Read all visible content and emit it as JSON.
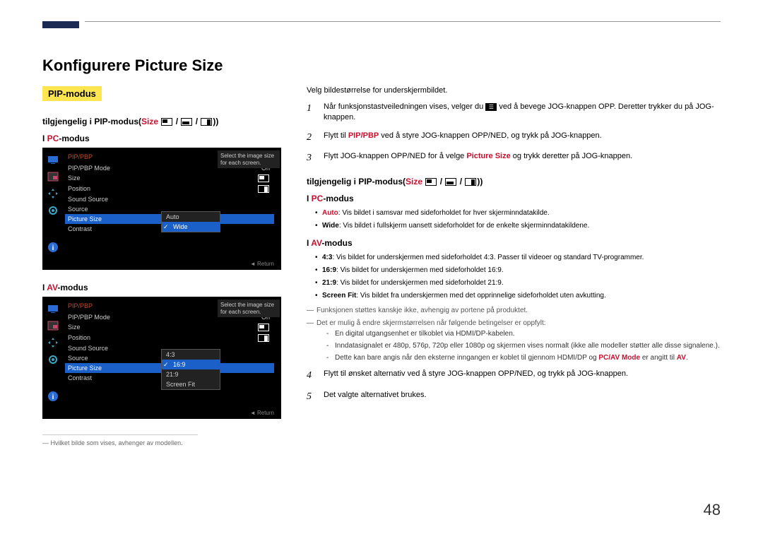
{
  "pageNumber": "48",
  "title": "Konfigurere Picture Size",
  "badge": "PIP-modus",
  "leftCol": {
    "subheadAvailable": "tilgjengelig i PIP-modus(",
    "subheadSize": "Size",
    "subheadEnd": "))",
    "pcModePrefix": "I ",
    "pcModeRed": "PC",
    "pcModeSuffix": "-modus",
    "avModePrefix": "I ",
    "avModeRed": "AV",
    "avModeSuffix": "-modus",
    "panel": {
      "title": "PIP/PBP",
      "rows": {
        "mode": "PIP/PBP Mode",
        "modeVal": "On",
        "size": "Size",
        "position": "Position",
        "soundSource": "Sound Source",
        "source": "Source",
        "pictureSize": "Picture Size",
        "contrast": "Contrast"
      },
      "tooltip": "Select the image size for each screen.",
      "returnLabel": "◄  Return",
      "popupPC": {
        "auto": "Auto",
        "wide": "Wide"
      },
      "popupAV": {
        "r43": "4:3",
        "r169": "16:9",
        "r219": "21:9",
        "fit": "Screen Fit"
      }
    }
  },
  "rightCol": {
    "intro": "Velg bildestørrelse for underskjermbildet.",
    "step1a": "Når funksjonstastveiledningen vises, velger du ",
    "step1b": " ved å bevege JOG-knappen OPP. Deretter trykker du på JOG-knappen.",
    "step2a": "Flytt til ",
    "step2pip": "PIP/PBP",
    "step2b": " ved å styre JOG-knappen OPP/NED, og trykk på JOG-knappen.",
    "step3a": "Flytt JOG-knappen OPP/NED for å velge ",
    "step3ps": "Picture Size",
    "step3b": " og trykk deretter på JOG-knappen.",
    "subheadAvailable": "tilgjengelig i PIP-modus(",
    "subheadSize": "Size",
    "subheadEnd": "))",
    "pcModePrefix": "I ",
    "pcModeRed": "PC",
    "pcModeSuffix": "-modus",
    "pcBullets": {
      "autoLabel": "Auto",
      "autoText": ": Vis bildet i samsvar med sideforholdet for hver skjerminndatakilde.",
      "wideLabel": "Wide",
      "wideText": ": Vis bildet i fullskjerm uansett sideforholdet for de enkelte skjerminndatakildene."
    },
    "avModePrefix": "I ",
    "avModeRed": "AV",
    "avModeSuffix": "-modus",
    "avBullets": {
      "r43Label": "4:3",
      "r43Text": ": Vis bildet for underskjermen med sideforholdet 4:3. Passer til videoer og standard TV-programmer.",
      "r169Label": "16:9",
      "r169Text": ": Vis bildet for underskjermen med sideforholdet 16:9.",
      "r219Label": "21:9",
      "r219Text": ": Vis bildet for underskjermen med sideforholdet 21:9.",
      "fitLabel": "Screen Fit",
      "fitText": ": Vis bildet fra underskjermen med det opprinnelige sideforholdet uten avkutting."
    },
    "dash1": "Funksjonen støttes kanskje ikke, avhengig av portene på produktet.",
    "dash2": "Det er mulig å endre skjermstørrelsen når følgende betingelser er oppfylt:",
    "sub1": "En digital utgangsenhet er tilkoblet via HDMI/DP-kabelen.",
    "sub2": "Inndatasignalet er 480p, 576p, 720p eller 1080p og skjermen vises normalt (ikke alle modeller støtter alle disse signalene.).",
    "sub3a": "Dette kan bare angis når den eksterne inngangen er koblet til gjennom HDMI/DP og ",
    "sub3pcav": "PC/AV Mode",
    "sub3b": " er angitt til ",
    "sub3av": "AV",
    "sub3c": ".",
    "step4": "Flytt til ønsket alternativ ved å styre JOG-knappen OPP/NED, og trykk på JOG-knappen.",
    "step5": "Det valgte alternativet brukes."
  },
  "footnote": "Hvilket bilde som vises, avhenger av modellen."
}
